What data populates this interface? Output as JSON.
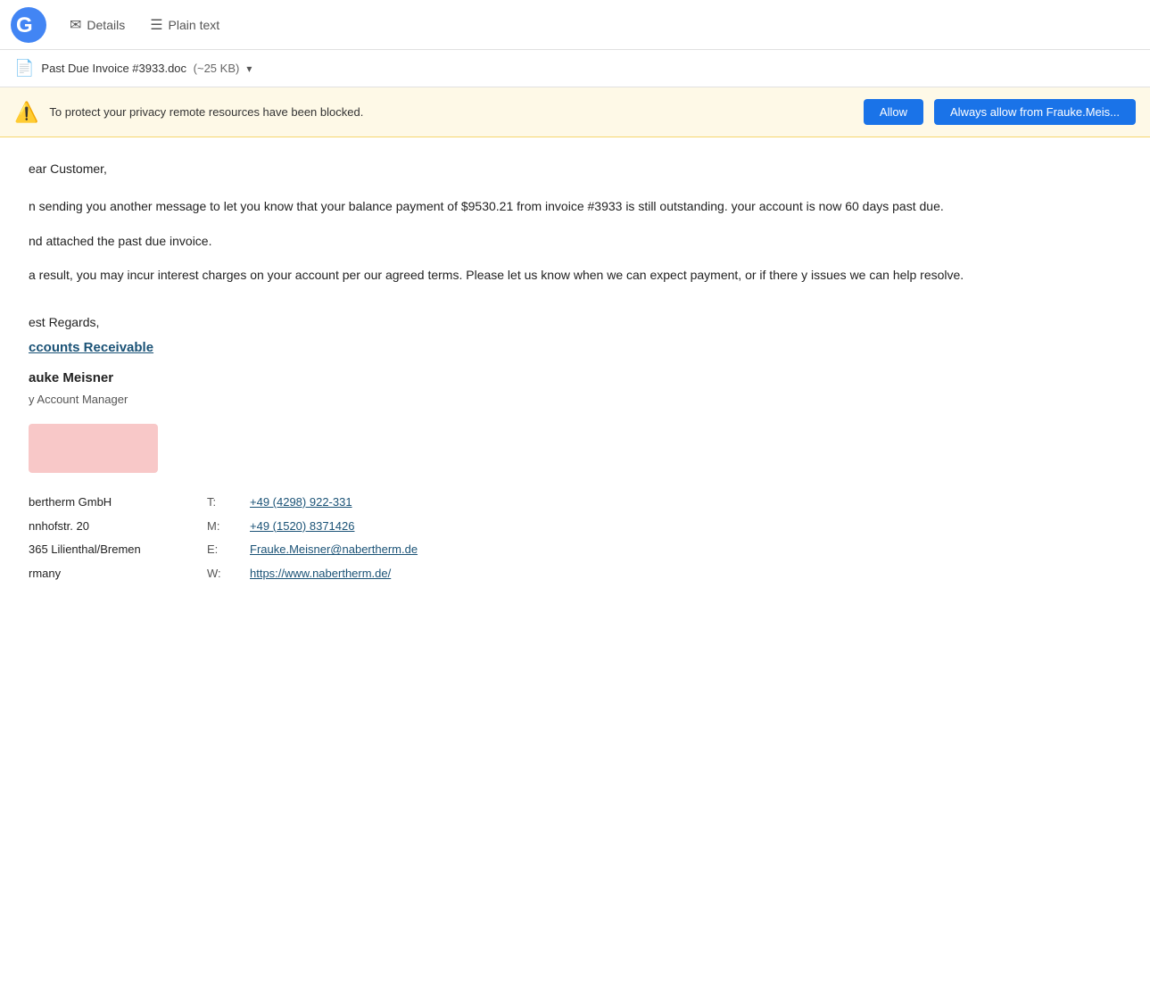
{
  "header": {
    "logo_text": "G",
    "nav_items": [
      {
        "id": "details",
        "icon": "✉",
        "label": "Details"
      },
      {
        "id": "plain-text",
        "icon": "☰",
        "label": "Plain text"
      }
    ]
  },
  "attachment": {
    "icon": "📄",
    "name": "Past Due Invoice #3933.doc",
    "size": "(~25 KB)",
    "dropdown_icon": "▾"
  },
  "privacy_banner": {
    "icon": "⚠",
    "text": "To protect your privacy remote resources have been blocked.",
    "allow_label": "Allow",
    "always_allow_label": "Always allow from Frauke.Meis..."
  },
  "email": {
    "greeting": "ear Customer,",
    "paragraph1": "n sending you another message to let you know that your balance payment of $9530.21 from invoice #3933 is still outstanding. your account is now 60 days past due.",
    "paragraph2": "nd attached the past due invoice.",
    "paragraph3": "a result, you may incur interest charges on your account per our agreed terms. Please let us know when we can expect payment, or if there y issues we can help resolve.",
    "best_regards": "est Regards,",
    "department_link": "ccounts Receivable",
    "sender_name": "auke Meisner",
    "sender_title": "y Account Manager",
    "company_name": "bertherm GmbH",
    "address_street": "nnhofstr. 20",
    "address_city": "365 Lilienthal/Bremen",
    "address_country": "rmany",
    "contact": {
      "t_label": "T:",
      "t_value": "+49 (4298) 922-331",
      "m_label": "M:",
      "m_value": "+49 (1520) 8371426",
      "e_label": "E:",
      "e_value": "Frauke.Meisner@nabertherm.de",
      "w_label": "W:",
      "w_value": "https://www.nabertherm.de/"
    }
  }
}
